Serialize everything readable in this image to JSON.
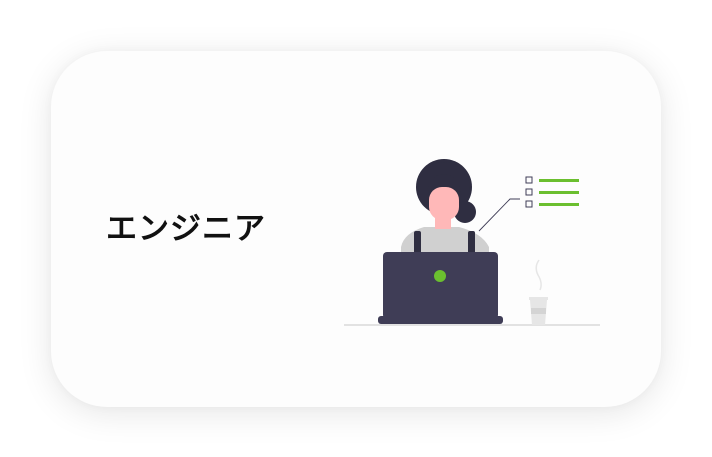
{
  "card": {
    "title": "エンジニア"
  },
  "illustration": {
    "subject": "person-working-at-laptop",
    "checklist_items": 3,
    "colors": {
      "accent_green": "#6bbf2f",
      "laptop": "#3f3d56",
      "hair": "#2f2e41",
      "skin": "#ffb8b8",
      "shirt": "#d0d0d0",
      "cup": "#e6e6e6",
      "desk_line": "#c8c8c8"
    }
  }
}
